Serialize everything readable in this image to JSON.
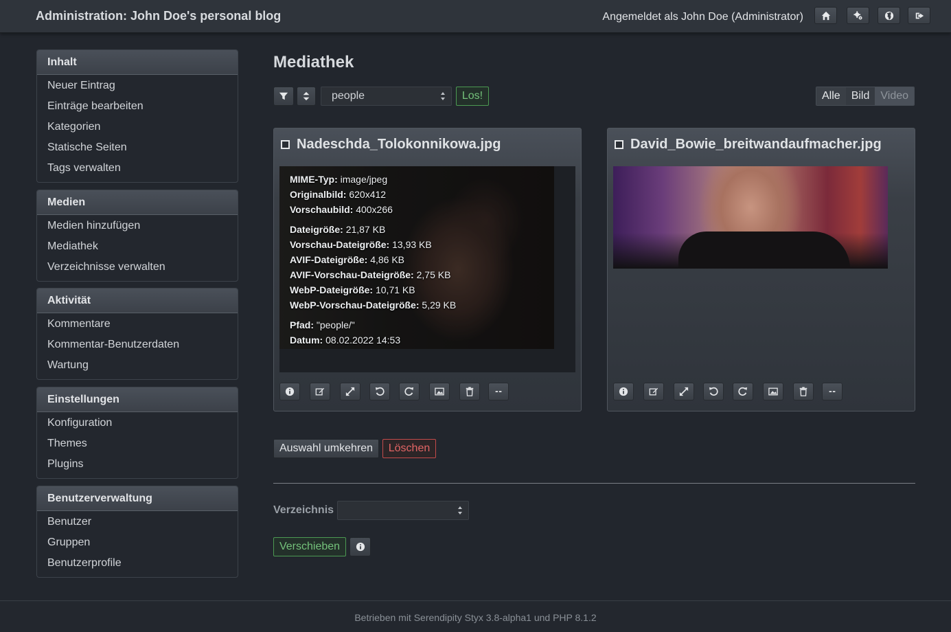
{
  "header": {
    "title": "Administration: John Doe's personal blog",
    "login_text": "Angemeldet als John Doe (Administrator)",
    "buttons": [
      "home-icon",
      "cogs-icon",
      "globe-icon",
      "logout-icon"
    ]
  },
  "sidebar": {
    "sections": [
      {
        "title": "Inhalt",
        "items": [
          "Neuer Eintrag",
          "Einträge bearbeiten",
          "Kategorien",
          "Statische Seiten",
          "Tags verwalten"
        ]
      },
      {
        "title": "Medien",
        "items": [
          "Medien hinzufügen",
          "Mediathek",
          "Verzeichnisse verwalten"
        ]
      },
      {
        "title": "Aktivität",
        "items": [
          "Kommentare",
          "Kommentar-Benutzerdaten",
          "Wartung"
        ]
      },
      {
        "title": "Einstellungen",
        "items": [
          "Konfiguration",
          "Themes",
          "Plugins"
        ]
      },
      {
        "title": "Benutzerverwaltung",
        "items": [
          "Benutzer",
          "Gruppen",
          "Benutzerprofile"
        ]
      }
    ]
  },
  "main": {
    "title": "Mediathek",
    "folder_select": "people",
    "go_label": "Los!",
    "filter": [
      "Alle",
      "Bild",
      "Video"
    ],
    "media": [
      {
        "filename": "Nadeschda_Tolokonnikowa.jpg",
        "info": {
          "mime_label": "MIME-Typ:",
          "mime": "image/jpeg",
          "orig_label": "Originalbild:",
          "orig": "620x412",
          "thumb_label": "Vorschaubild:",
          "thumb": "400x266",
          "size_label": "Dateigröße:",
          "size": "21,87 KB",
          "thumb_size_label": "Vorschau-Dateigröße:",
          "thumb_size": "13,93 KB",
          "avif_label": "AVIF-Dateigröße:",
          "avif": "4,86 KB",
          "avif_thumb_label": "AVIF-Vorschau-Dateigröße:",
          "avif_thumb": "2,75 KB",
          "webp_label": "WebP-Dateigröße:",
          "webp": "10,71 KB",
          "webp_thumb_label": "WebP-Vorschau-Dateigröße:",
          "webp_thumb": "5,29 KB",
          "path_label": "Pfad:",
          "path": "\"people/\"",
          "date_label": "Datum:",
          "date": "08.02.2022 14:53"
        }
      },
      {
        "filename": "David_Bowie_breitwandaufmacher.jpg"
      }
    ],
    "toolbar_icons": [
      "info-icon",
      "edit-icon",
      "resize-icon",
      "rotate-left-icon",
      "rotate-right-icon",
      "image-icon",
      "trash-icon",
      "more-icon"
    ],
    "invert_selection_label": "Auswahl umkehren",
    "delete_label": "Löschen",
    "directory_label": "Verzeichnis",
    "move_label": "Verschieben"
  },
  "footer": {
    "text": "Betrieben mit Serendipity Styx 3.8-alpha1 und PHP 8.1.2"
  }
}
